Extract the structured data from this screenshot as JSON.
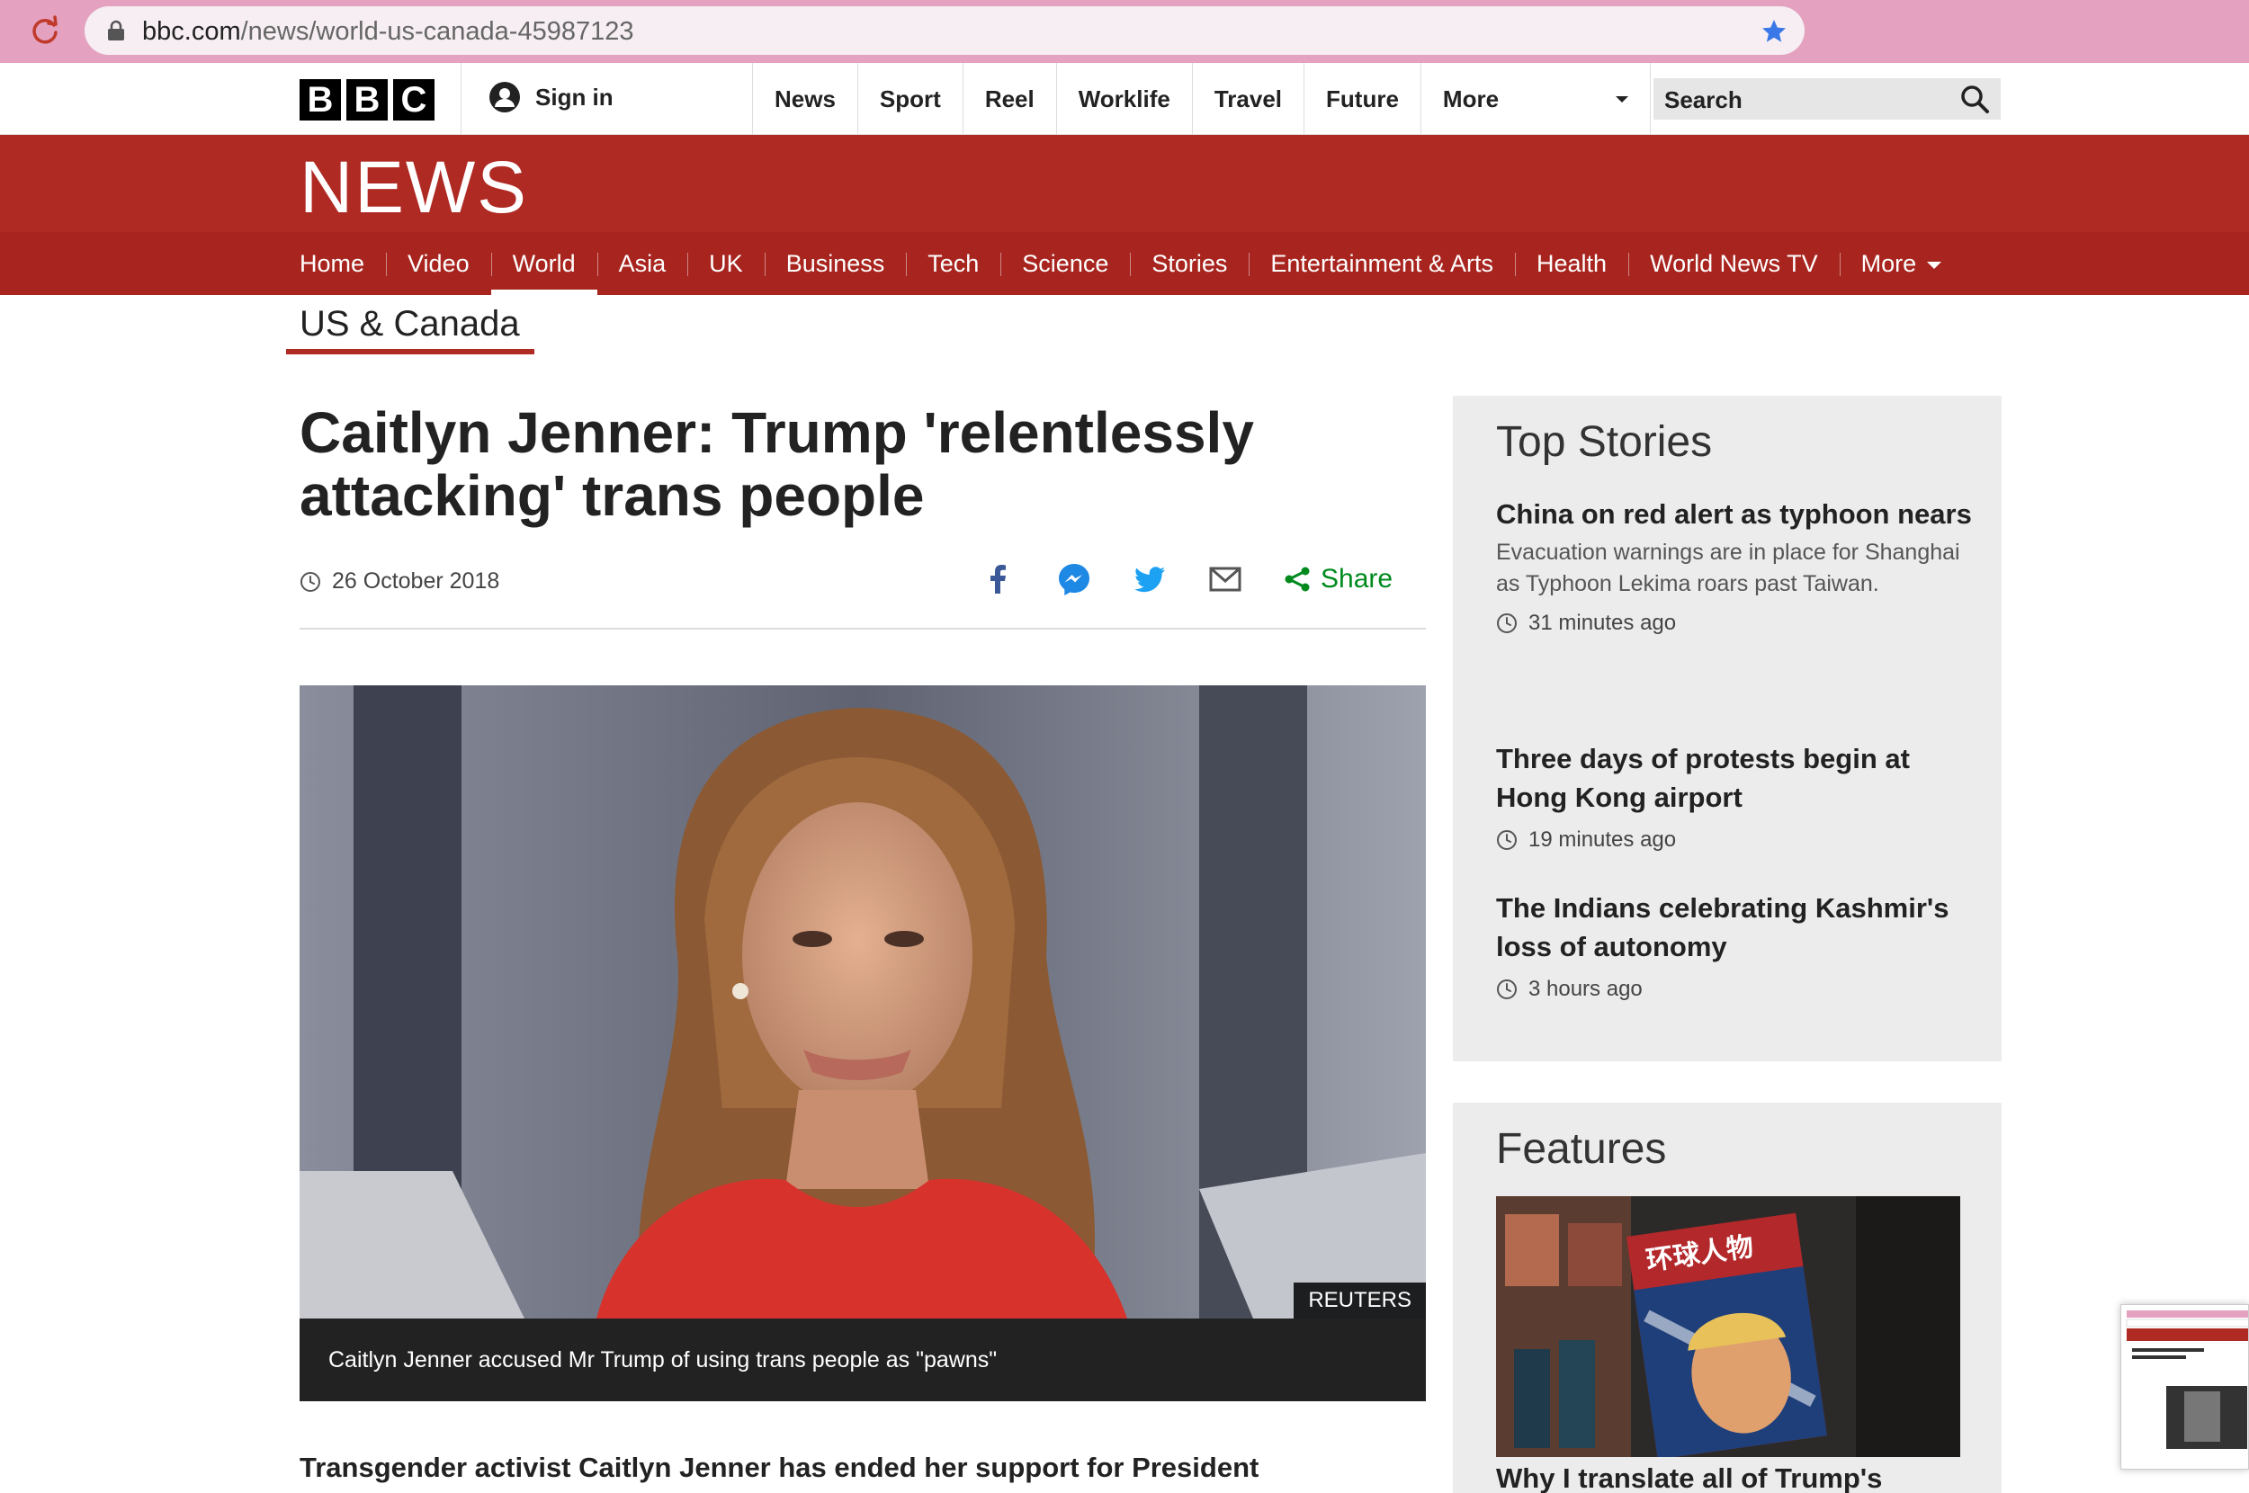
{
  "browser": {
    "url_host": "bbc.com",
    "url_path": "/news/world-us-canada-45987123"
  },
  "masthead": {
    "logo_letters": [
      "B",
      "B",
      "C"
    ],
    "signin_label": "Sign in",
    "nav": [
      "News",
      "Sport",
      "Reel",
      "Worklife",
      "Travel",
      "Future"
    ],
    "more_label": "More",
    "search_placeholder": "Search"
  },
  "banner": {
    "title": "NEWS"
  },
  "section_nav": {
    "tabs": [
      "Home",
      "Video",
      "World",
      "Asia",
      "UK",
      "Business",
      "Tech",
      "Science",
      "Stories",
      "Entertainment & Arts",
      "Health",
      "World News TV"
    ],
    "active": "World",
    "more_label": "More"
  },
  "subsection": "US & Canada",
  "article": {
    "headline": "Caitlyn Jenner: Trump 'relentlessly attacking' trans people",
    "date": "26 October 2018",
    "share_label": "Share",
    "share_icons": [
      "facebook-icon",
      "messenger-icon",
      "twitter-icon",
      "email-icon",
      "share-icon"
    ],
    "image_credit": "REUTERS",
    "caption": "Caitlyn Jenner accused Mr Trump of using trans people as \"pawns\"",
    "intro": "Transgender activist Caitlyn Jenner has ended her support for President"
  },
  "top_stories": {
    "heading": "Top Stories",
    "items": [
      {
        "title": "China on red alert as typhoon nears",
        "summary": "Evacuation warnings are in place for Shanghai as Typhoon Lekima roars past Taiwan.",
        "time": "31 minutes ago"
      },
      {
        "title": "Three days of protests begin at Hong Kong airport",
        "summary": "",
        "time": "19 minutes ago"
      },
      {
        "title": "The Indians celebrating Kashmir's loss of autonomy",
        "summary": "",
        "time": "3 hours ago"
      }
    ]
  },
  "features": {
    "heading": "Features",
    "magazine_title": "环球人物",
    "title": "Why I translate all of Trump's"
  },
  "colors": {
    "bbc_red": "#b02a24",
    "bbc_red_dark": "#a8251f",
    "share_green": "#008a1e",
    "chrome_pink": "#e4a2c0"
  }
}
